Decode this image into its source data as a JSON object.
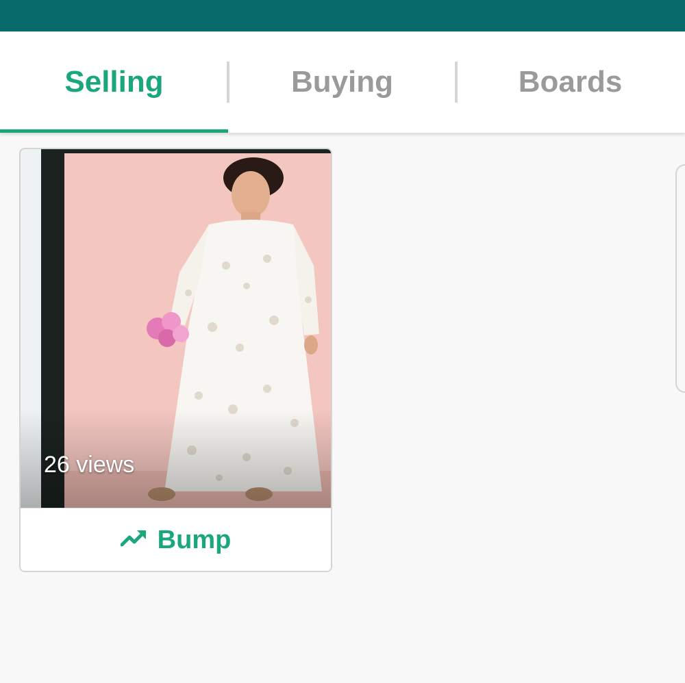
{
  "tabs": [
    {
      "label": "Selling",
      "active": true
    },
    {
      "label": "Buying",
      "active": false
    },
    {
      "label": "Boards",
      "active": false
    }
  ],
  "listing": {
    "views": "26 views",
    "bump_label": "Bump",
    "bump_icon": "trending-up-icon"
  },
  "colors": {
    "status_bar": "#086b6b",
    "accent": "#1aa77d",
    "tab_inactive": "#9a9a9a",
    "background": "#f8f8f8"
  }
}
